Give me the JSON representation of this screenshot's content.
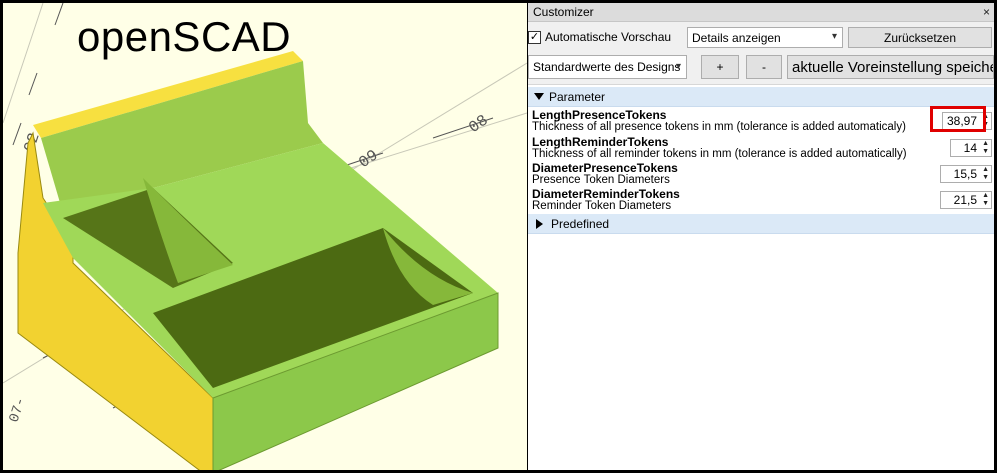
{
  "viewport": {
    "overlay_title": "openSCAD",
    "axis_ticks": [
      "08",
      "09",
      "02",
      "07-"
    ]
  },
  "customizer": {
    "title": "Customizer",
    "close_glyph": "×",
    "auto_preview_label": "Automatische Vorschau",
    "auto_preview_checked": true,
    "details_select": "Details anzeigen",
    "reset_button": "Zurücksetzen",
    "preset_select": "Standardwerte des Designs",
    "plus_button": "+",
    "minus_button": "-",
    "save_preset_button": "aktuelle Voreinstellung speichern",
    "groups": [
      {
        "label": "Parameter",
        "expanded": true,
        "params": [
          {
            "name": "LengthPresenceTokens",
            "description": "Thickness of all presence tokens in mm (tolerance is added automaticaly)",
            "value": "38,97"
          },
          {
            "name": "LengthReminderTokens",
            "description": "Thickness of all reminder tokens in mm (tolerance is added automatically)",
            "value": "14"
          },
          {
            "name": "DiameterPresenceTokens",
            "description": "Presence Token Diameters",
            "value": "15,5"
          },
          {
            "name": "DiameterReminderTokens",
            "description": "Reminder Token Diameters",
            "value": "21,5"
          }
        ]
      },
      {
        "label": "Predefined",
        "expanded": false
      }
    ]
  },
  "colors": {
    "model_top": "#a0d858",
    "model_side_yellow": "#f2d230",
    "model_shadow": "#5d7a1e",
    "viewport_bg": "#ffffe7",
    "highlight": "#e00000"
  }
}
